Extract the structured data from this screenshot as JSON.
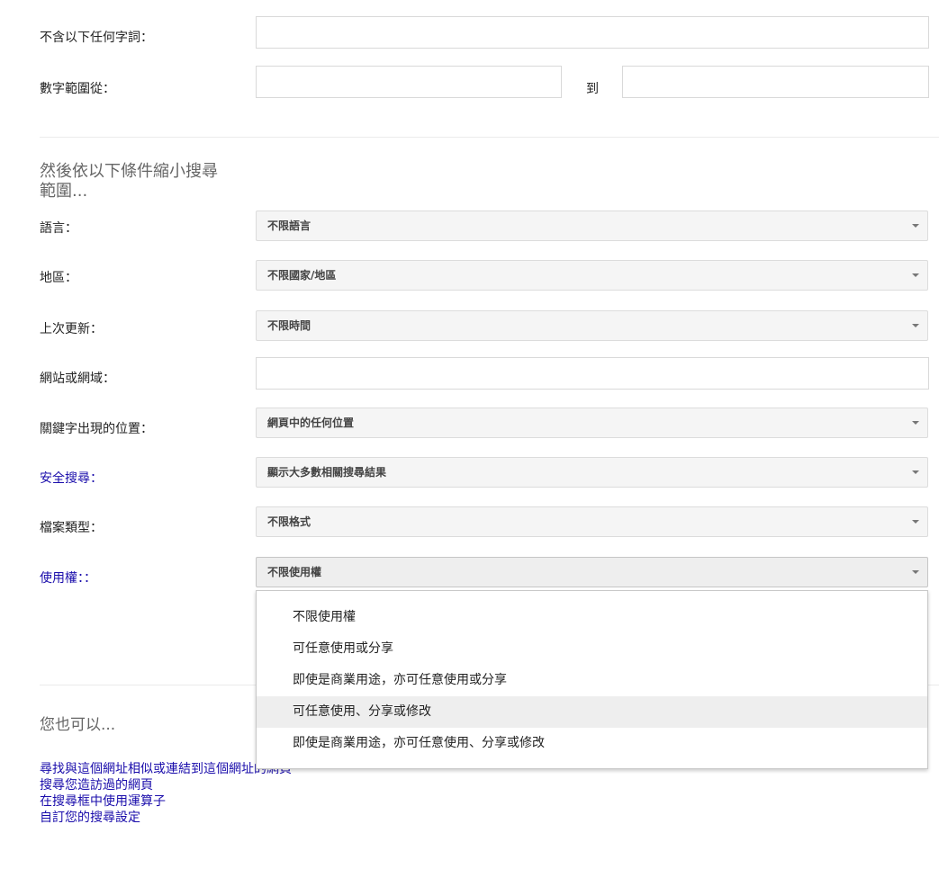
{
  "exclude_words": {
    "label": "不含以下任何字詞：",
    "value": ""
  },
  "number_range": {
    "label": "數字範圍從：",
    "to_label": "到",
    "from_value": "",
    "to_value": ""
  },
  "narrow_section": {
    "heading_line1": "然後依以下條件縮小搜尋",
    "heading_line2": "範圍..."
  },
  "language": {
    "label": "語言：",
    "value": "不限語言"
  },
  "region": {
    "label": "地區：",
    "value": "不限國家/地區"
  },
  "last_update": {
    "label": "上次更新：",
    "value": "不限時間"
  },
  "site_domain": {
    "label": "網站或網域：",
    "value": ""
  },
  "terms_appearing": {
    "label": "關鍵字出現的位置：",
    "value": "網頁中的任何位置"
  },
  "safe_search": {
    "label": "安全搜尋：",
    "value": "顯示大多數相關搜尋結果"
  },
  "file_type": {
    "label": "檔案類型：",
    "value": "不限格式"
  },
  "usage_rights": {
    "label": "使用權：：",
    "value": "不限使用權",
    "options": [
      "不限使用權",
      "可任意使用或分享",
      "即使是商業用途，亦可任意使用或分享",
      "可任意使用、分享或修改",
      "即使是商業用途，亦可任意使用、分享或修改"
    ],
    "highlighted_option": "可任意使用、分享或修改"
  },
  "also_section": {
    "heading": "您也可以...",
    "links": [
      "尋找與這個網址相似或連結到這個網址的網頁",
      "搜尋您造訪過的網頁",
      "在搜尋框中使用運算子",
      "自訂您的搜尋設定"
    ]
  },
  "colors": {
    "link": "#1a0dab",
    "heading": "#666666",
    "select_bg": "#f5f5f5",
    "hover_bg": "#eeeeee"
  }
}
